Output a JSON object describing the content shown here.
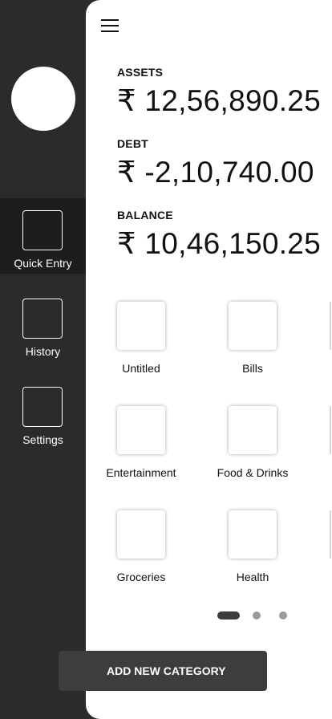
{
  "sidebar": {
    "items": [
      {
        "label": "Quick Entry",
        "active": true
      },
      {
        "label": "History",
        "active": false
      },
      {
        "label": "Settings",
        "active": false
      }
    ]
  },
  "summary": {
    "assets": {
      "label": "ASSETS",
      "value": "₹ 12,56,890.25"
    },
    "debt": {
      "label": "DEBT",
      "value": "₹ -2,10,740.00"
    },
    "balance": {
      "label": "BALANCE",
      "value": "₹ 10,46,150.25"
    }
  },
  "categories": [
    {
      "label": "Untitled"
    },
    {
      "label": "Bills"
    },
    {
      "label": "Entertainment"
    },
    {
      "label": "Food & Drinks"
    },
    {
      "label": "Groceries"
    },
    {
      "label": "Health"
    }
  ],
  "pagination": {
    "pages": 3,
    "current": 1
  },
  "actions": {
    "add_category_label": "ADD NEW CATEGORY"
  },
  "colors": {
    "sidebar_bg": "#2b2b2b",
    "sidebar_active_bg": "#1d1d1d",
    "button_bg": "#3d3d3d",
    "dot_active": "#3d3d3d",
    "dot_inactive": "#9a9a9a"
  }
}
